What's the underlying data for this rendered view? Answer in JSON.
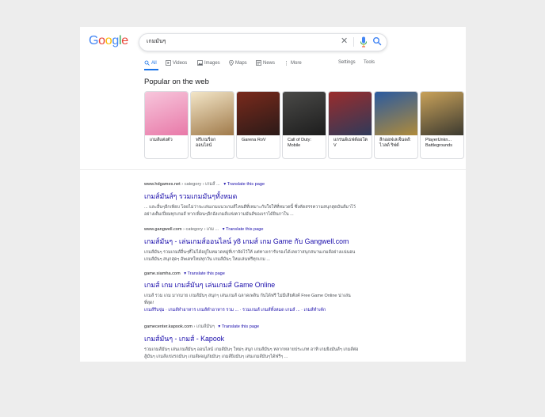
{
  "search": {
    "query": "เกมมันๆ",
    "clear_symbol": "✕"
  },
  "tabs": [
    {
      "label": "All",
      "icon": "search-icon",
      "active": true
    },
    {
      "label": "Videos",
      "icon": "video-icon"
    },
    {
      "label": "Images",
      "icon": "image-icon"
    },
    {
      "label": "Maps",
      "icon": "map-pin-icon"
    },
    {
      "label": "News",
      "icon": "news-icon"
    },
    {
      "label": "More",
      "icon": "more-vert-icon"
    },
    {
      "label": "Settings"
    },
    {
      "label": "Tools"
    }
  ],
  "popular": {
    "title": "Popular on the web",
    "cards": [
      {
        "label": "เกมส์แต่งตัว",
        "colors": [
          "#f7c6dc",
          "#e879a8"
        ]
      },
      {
        "label": "ฟรีเกมร็อก ออนไลน์",
        "colors": [
          "#f3e6c8",
          "#a07a4a"
        ]
      },
      {
        "label": "Garena RoV",
        "colors": [
          "#7a2a1c",
          "#2b1a18"
        ]
      },
      {
        "label": "Call of Duty: Mobile",
        "colors": [
          "#4a4a48",
          "#1d1d1d"
        ]
      },
      {
        "label": "แกรนด์เธฟต์ออโต V",
        "colors": [
          "#9a2c2c",
          "#2f3a5a"
        ]
      },
      {
        "label": "ลีกออฟเลเจ็นดส์: ไวลด์ ริฟต์",
        "colors": [
          "#2a5aa0",
          "#b08b3a"
        ]
      },
      {
        "label": "PlayerUnknown's Battlegrounds",
        "short": "PlayerUnkn... Battlegrounds",
        "colors": [
          "#c9a25a",
          "#3c3a30"
        ]
      }
    ]
  },
  "results": [
    {
      "domain": "www.hdgames.net",
      "crumb": "› category › เกมส์ ...",
      "translate": "Translate this page",
      "title": "เกมส์มันส์ๆ รวมเกมมันๆทั้งหมด",
      "snippet": "... และอื่นๆอีกเพียบ โดยไม่ว่าจะเล่นเกมแนวเกมส์ไหนดีที่เหมาะกับใจให้ที่หมวดนี้ ซึ่งคัดสรรความสนุกสุดมันส์มาไว้อย่างเต็มเปี่ยมทุกเกมส์ หากเพื่อนๆอีกอังเกมส์แห่งความมันส์ของเราได้ยินกาใน ..."
    },
    {
      "domain": "www.gangwell.com",
      "crumb": "› category › เกม ...",
      "translate": "Translate this page",
      "title": "เกมส์มันๆ - เล่นเกมส์ออนไลน์ y8 เกมส์ เกม Game กับ Gangwell.com",
      "snippet": "เกมส์มันๆ รวมเกมส์อื่นๆที่ไม่ได้อยู่ในหมวดหมู่ที่เราจัดไว้ให้ แต่ทางเรารับรองได้เลยว่าสนุกสนานเกมส์อย่างแน่นอนเกมส์มันๆ สนุกสุดๆ อัพเดทใหม่ทุกวัน เกมส์มันๆ ใหมเล่นฟรีทุกเกม ..."
    },
    {
      "domain": "game.siamha.com",
      "crumb": "",
      "translate": "Translate this page",
      "title": "เกมส์ เกม เกมส์มันๆ เล่นเกมส์ Game Online",
      "snippet": "เกมส์ รวม เกม มากมาย เกมส์มันๆ สนุกๆ เล่นเกมส์ ฉลาดเพลิน กันได้ฟรี ไม่มีเสียตังค์ Free Game Online น่าเล่นที่สุด!",
      "links": "เกมส์รีบจุ่ม · เกมส์ทำอาหาร เกมส์ทำอาหาร รวม ... · รวมเกมส์ เกมส์ทั้งหมด เกมส์ ... · เกมส์ทำเค้ก"
    },
    {
      "domain": "gamecenter.kapook.com",
      "crumb": "› เกมส์มันๆ",
      "translate": "Translate this page",
      "title": "เกมส์มันๆ - เกมส์ - Kapook",
      "snippet": "รวมเกมส์มันๆ เล่นเกมส์มันๆ ออนไลน์ เกมส์มันๆ ใหม่ๆ สนุก เกมส์มันๆ หลากหลายประเภท อาทิ เกมยิงมันส์ๆ เกมส์ต่อสู้มันๆ เกมส์แข่งรถมันๆ เกมส์ผจญภัยมันๆ เกมส์ยิงมันๆ เล่นเกมส์มันๆได้ฟรีๆ ..."
    }
  ]
}
